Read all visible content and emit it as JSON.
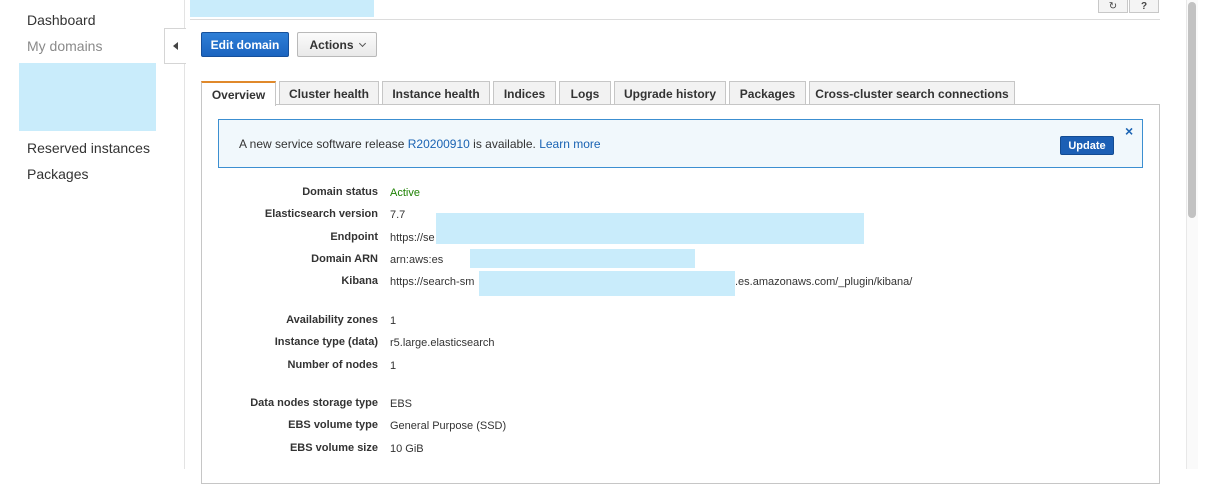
{
  "sidebar": {
    "dashboard": "Dashboard",
    "my_domains": "My domains",
    "reserved_instances": "Reserved instances",
    "packages": "Packages"
  },
  "toolbar": {
    "refresh_icon": "refresh-icon",
    "help_icon": "help-icon",
    "edit_domain": "Edit domain",
    "actions": "Actions"
  },
  "tabs": [
    {
      "label": "Overview",
      "active": true
    },
    {
      "label": "Cluster health"
    },
    {
      "label": "Instance health"
    },
    {
      "label": "Indices"
    },
    {
      "label": "Logs"
    },
    {
      "label": "Upgrade history"
    },
    {
      "label": "Packages"
    },
    {
      "label": "Cross-cluster search connections"
    }
  ],
  "notice": {
    "prefix": "A new service software release ",
    "release": "R20200910",
    "suffix": " is available. ",
    "learn_more": "Learn more",
    "update": "Update",
    "close": "×"
  },
  "details": {
    "domain_status": {
      "label": "Domain status",
      "value": "Active"
    },
    "es_version": {
      "label": "Elasticsearch version",
      "value": "7.7"
    },
    "endpoint": {
      "label": "Endpoint",
      "value": "https://se"
    },
    "domain_arn": {
      "label": "Domain ARN",
      "value": "arn:aws:es"
    },
    "kibana": {
      "label": "Kibana",
      "value_start": "https://search-sm",
      "value_end": ".es.amazonaws.com/_plugin/kibana/"
    },
    "availability_zones": {
      "label": "Availability zones",
      "value": "1"
    },
    "instance_type": {
      "label": "Instance type (data)",
      "value": "r5.large.elasticsearch"
    },
    "number_of_nodes": {
      "label": "Number of nodes",
      "value": "1"
    },
    "storage_type": {
      "label": "Data nodes storage type",
      "value": "EBS"
    },
    "ebs_volume_type": {
      "label": "EBS volume type",
      "value": "General Purpose (SSD)"
    },
    "ebs_volume_size": {
      "label": "EBS volume size",
      "value": "10 GiB"
    }
  },
  "colors": {
    "primary_button": "#1b64c0",
    "active_tab_accent": "#e0892b",
    "status_active": "#1d8102",
    "link": "#1a63b3",
    "redaction": "#c9ecfb"
  }
}
